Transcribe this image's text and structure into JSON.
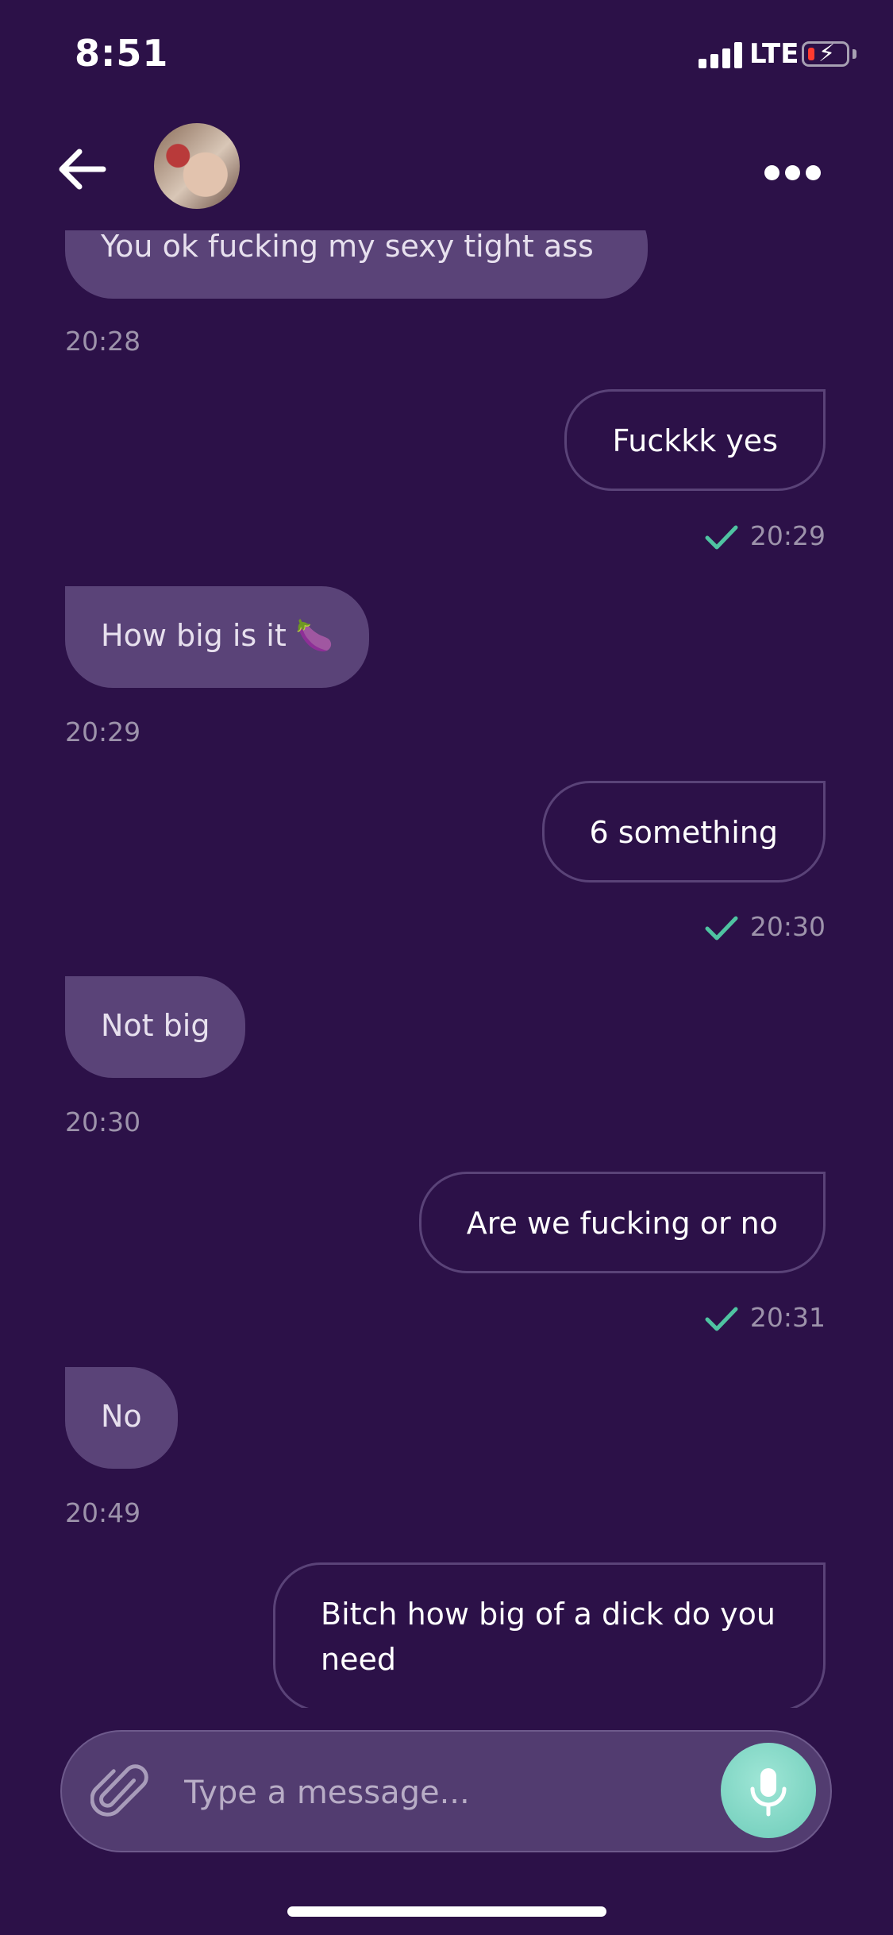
{
  "status_bar": {
    "time": "8:51",
    "network": "LTE"
  },
  "header": {
    "back_icon": "arrow-left-icon",
    "more_icon": "ellipsis-icon"
  },
  "messages": [
    {
      "direction": "in",
      "text": "You ok fucking my sexy tight ass",
      "time": "20:28"
    },
    {
      "direction": "out",
      "text": "Fuckkk yes",
      "time": "20:29",
      "status": "sent"
    },
    {
      "direction": "in",
      "text": "How big is it 🍆",
      "time": "20:29"
    },
    {
      "direction": "out",
      "text": "6 something",
      "time": "20:30",
      "status": "sent"
    },
    {
      "direction": "in",
      "text": "Not big",
      "time": "20:30"
    },
    {
      "direction": "out",
      "text": "Are we fucking or no",
      "time": "20:31",
      "status": "sent"
    },
    {
      "direction": "in",
      "text": "No",
      "time": "20:49"
    },
    {
      "direction": "out",
      "text": "Bitch how big of a dick do you need"
    }
  ],
  "composer": {
    "placeholder": "Type a message...",
    "attach_icon": "paperclip-icon",
    "mic_icon": "microphone-icon"
  },
  "colors": {
    "background": "#2c1148",
    "incoming_bubble": "#5a4378",
    "accent": "#6ccbb8",
    "check": "#4fc3a1"
  }
}
